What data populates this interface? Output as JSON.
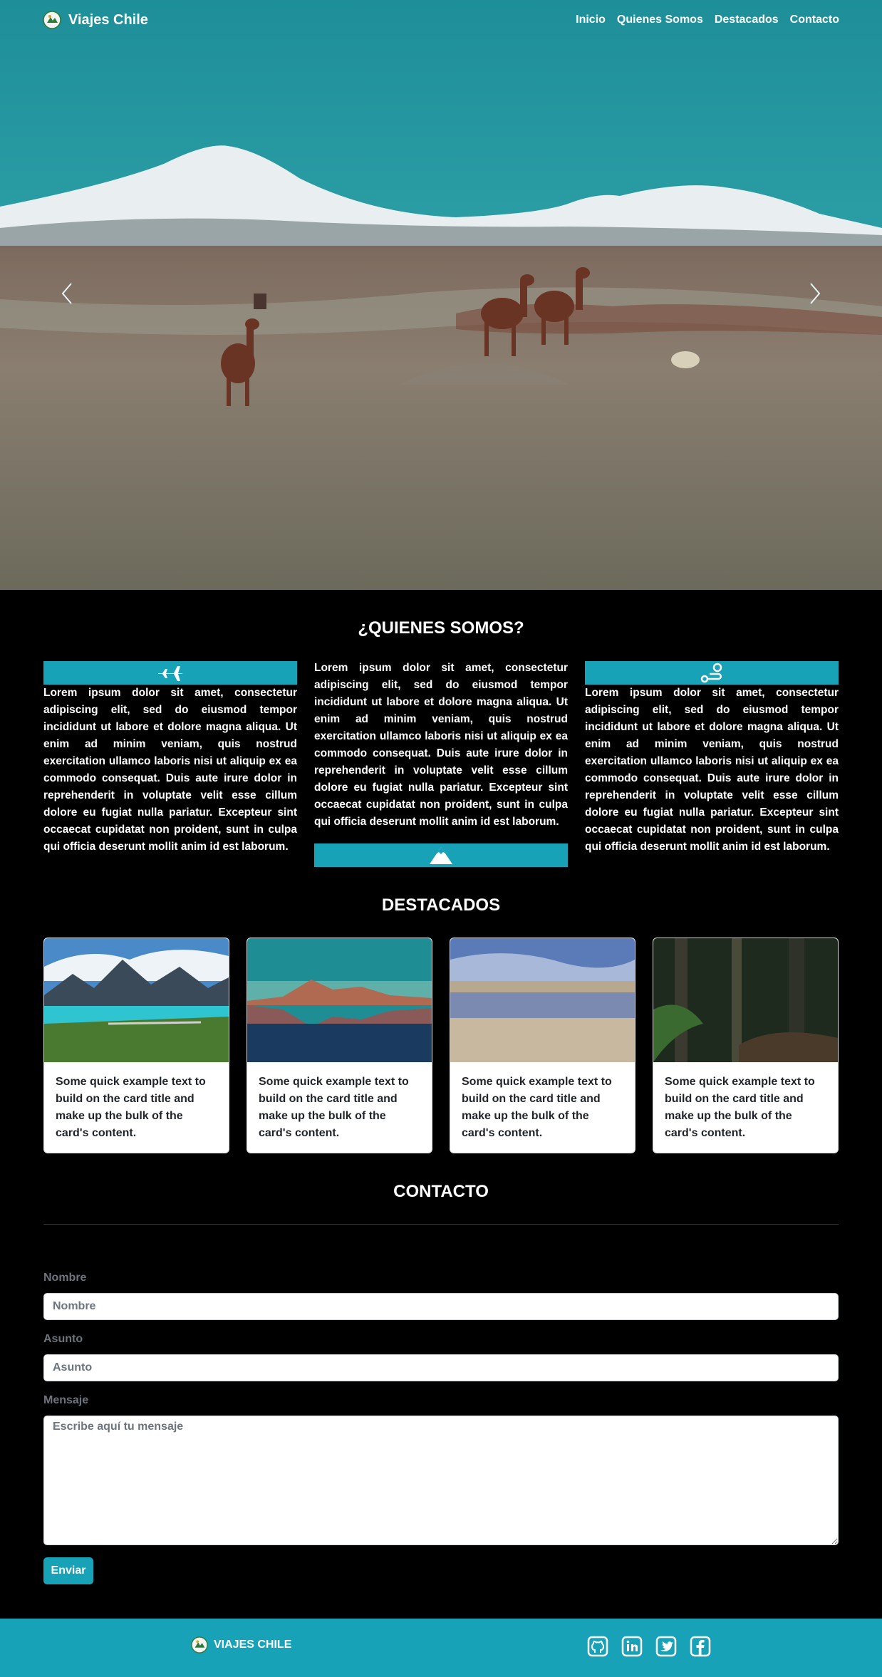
{
  "nav": {
    "brand": "Viajes Chile",
    "links": [
      "Inicio",
      "Quienes Somos",
      "Destacados",
      "Contacto"
    ]
  },
  "quienes": {
    "title": "¿QUIENES SOMOS?",
    "text": "Lorem ipsum dolor sit amet, consectetur adipiscing elit, sed do eiusmod tempor incididunt ut labore et dolore magna aliqua. Ut enim ad minim veniam, quis nostrud exercitation ullamco laboris nisi ut aliquip ex ea commodo consequat. Duis aute irure dolor in reprehenderit in voluptate velit esse cillum dolore eu fugiat nulla pariatur. Excepteur sint occaecat cupidatat non proident, sunt in culpa qui officia deserunt mollit anim id est laborum.",
    "icons": [
      "plane-icon",
      "mountain-icon",
      "route-icon"
    ]
  },
  "destacados": {
    "title": "DESTACADOS",
    "cards": [
      {
        "text": "Some quick example text to build on the card title and make up the bulk of the card's content."
      },
      {
        "text": "Some quick example text to build on the card title and make up the bulk of the card's content."
      },
      {
        "text": "Some quick example text to build on the card title and make up the bulk of the card's content."
      },
      {
        "text": "Some quick example text to build on the card title and make up the bulk of the card's content."
      }
    ]
  },
  "contacto": {
    "title": "CONTACTO",
    "nombre_label": "Nombre",
    "nombre_placeholder": "Nombre",
    "asunto_label": "Asunto",
    "asunto_placeholder": "Asunto",
    "mensaje_label": "Mensaje",
    "mensaje_placeholder": "Escribe aquí tu mensaje",
    "submit": "Enviar"
  },
  "footer": {
    "brand": "VIAJES CHILE",
    "socials": [
      "github-icon",
      "linkedin-icon",
      "twitter-icon",
      "facebook-icon"
    ]
  },
  "colors": {
    "accent": "#17a2b8",
    "background": "#000000"
  }
}
